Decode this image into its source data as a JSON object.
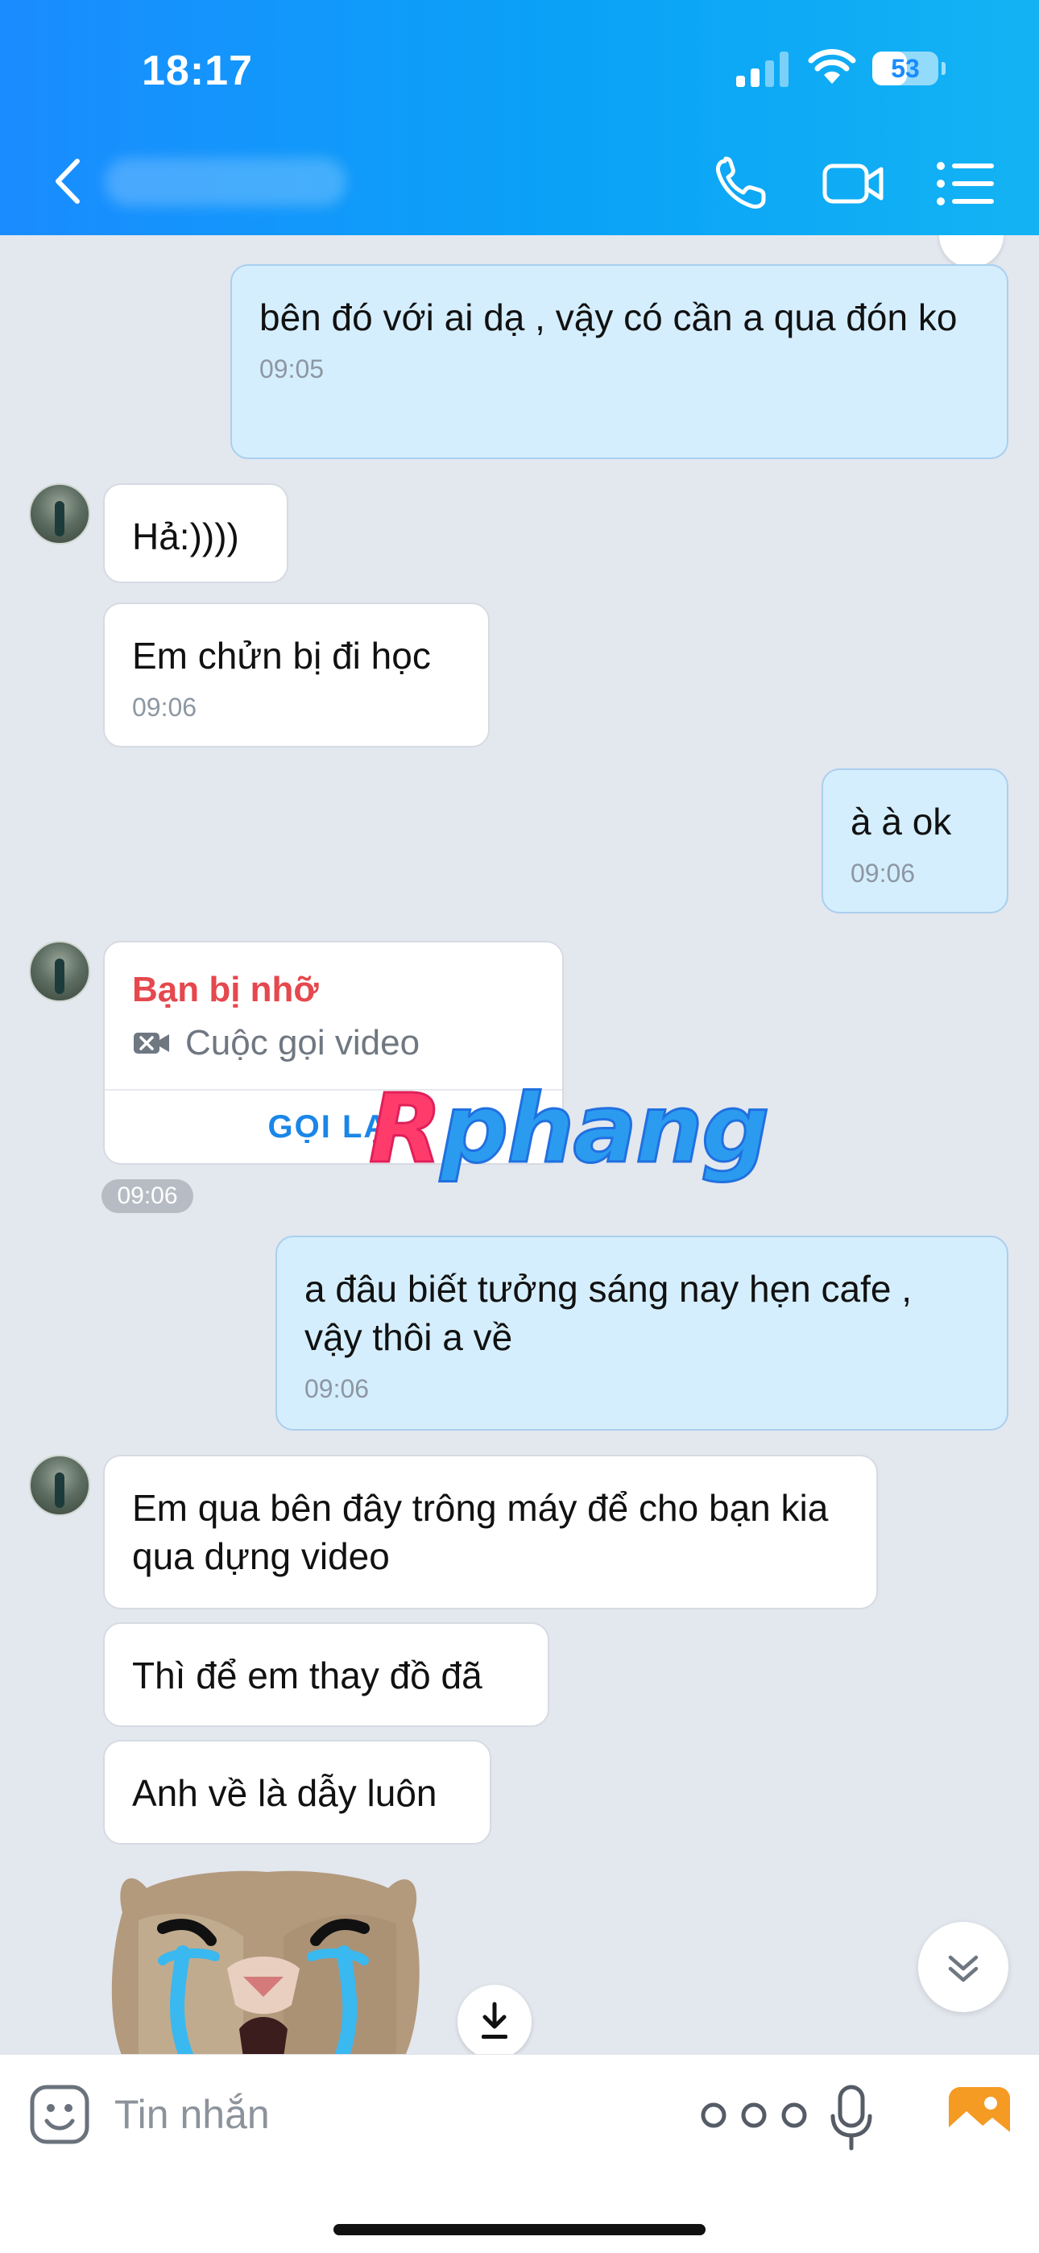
{
  "status_bar": {
    "time": "18:17",
    "battery": "53",
    "battery_level": 0.53
  },
  "header": {
    "contact_name": ""
  },
  "messages": [
    {
      "text": "bên đó với ai dạ , vậy có cần a qua đón ko",
      "time": "09:05"
    },
    {
      "text": "Hả:))))"
    },
    {
      "text": "Em chửn bị đi học",
      "time": "09:06"
    },
    {
      "text": "à à ok",
      "time": "09:06"
    },
    {
      "text": "a đâu biết tưởng sáng nay hẹn cafe , vậy thôi a về",
      "time": "09:06"
    },
    {
      "text": "Em qua bên đây trông máy để cho bạn kia qua dựng video"
    },
    {
      "text": "Thì để em thay đồ đã"
    },
    {
      "text": "Anh về là dẫy luôn"
    }
  ],
  "missed_call": {
    "title": "Bạn bị nhỡ",
    "subtitle": "Cuộc gọi video",
    "action": "GỌI LẠI",
    "time": "09:06"
  },
  "watermark": {
    "first": "R",
    "rest": "phang"
  },
  "input": {
    "placeholder": "Tin nhắn",
    "value": ""
  },
  "colors": {
    "header_start": "#1a8cff",
    "header_end": "#13b3f3",
    "outgoing_bubble": "#d5eefe",
    "incoming_bubble": "#ffffff",
    "missed": "#e5484d",
    "link": "#1a86e8"
  }
}
